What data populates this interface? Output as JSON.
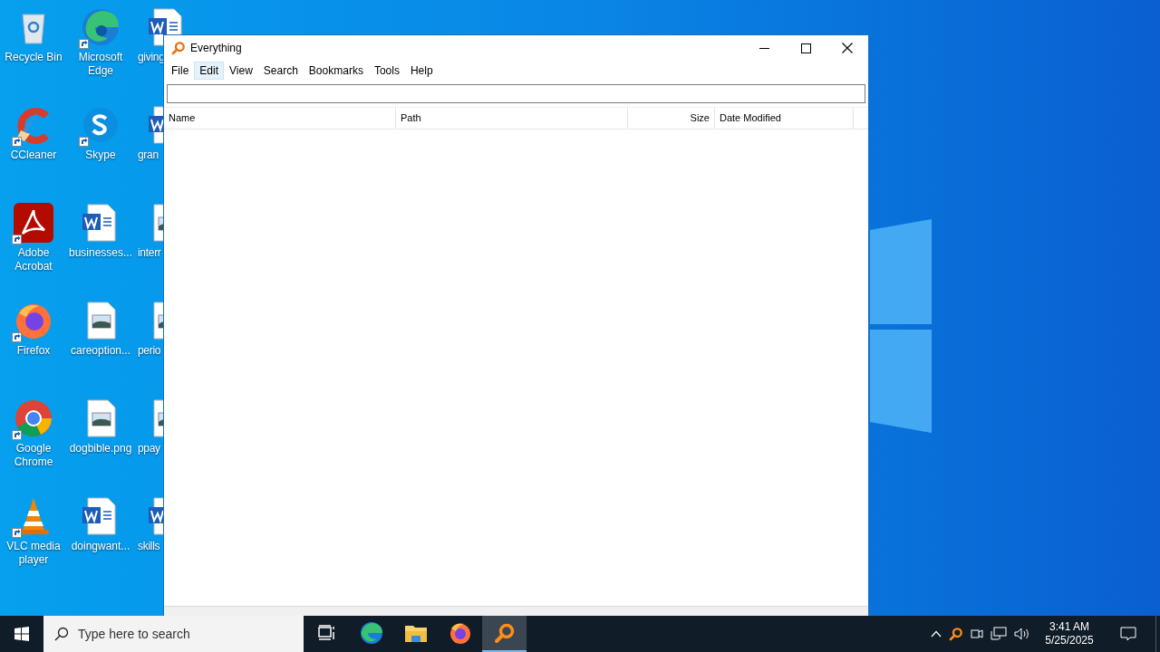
{
  "desktop": {
    "icons": [
      {
        "label": "Recycle Bin",
        "kind": "recycle",
        "shortcut": false
      },
      {
        "label": "CCleaner",
        "kind": "ccleaner",
        "shortcut": true
      },
      {
        "label": "Adobe Acrobat",
        "kind": "acrobat",
        "shortcut": true
      },
      {
        "label": "Firefox",
        "kind": "firefox",
        "shortcut": true
      },
      {
        "label": "Google Chrome",
        "kind": "chrome",
        "shortcut": true
      },
      {
        "label": "VLC media player",
        "kind": "vlc",
        "shortcut": true
      },
      {
        "label": "Microsoft Edge",
        "kind": "edge",
        "shortcut": true
      },
      {
        "label": "Skype",
        "kind": "skype",
        "shortcut": true
      },
      {
        "label": "businesses...",
        "kind": "word",
        "shortcut": false
      },
      {
        "label": "careoption...",
        "kind": "image",
        "shortcut": false
      },
      {
        "label": "dogbible.png",
        "kind": "image",
        "shortcut": false
      },
      {
        "label": "doingwant...",
        "kind": "word",
        "shortcut": false
      },
      {
        "label": "giving",
        "kind": "word",
        "shortcut": false
      },
      {
        "label": "gran",
        "kind": "word",
        "shortcut": false
      },
      {
        "label": "interr",
        "kind": "image",
        "shortcut": false
      },
      {
        "label": "perio",
        "kind": "image",
        "shortcut": false
      },
      {
        "label": "ppay",
        "kind": "image",
        "shortcut": false
      },
      {
        "label": "skills",
        "kind": "word",
        "shortcut": false
      }
    ]
  },
  "window": {
    "title": "Everything",
    "menu": [
      {
        "label": "File",
        "selected": false
      },
      {
        "label": "Edit",
        "selected": true
      },
      {
        "label": "View",
        "selected": false
      },
      {
        "label": "Search",
        "selected": false
      },
      {
        "label": "Bookmarks",
        "selected": false
      },
      {
        "label": "Tools",
        "selected": false
      },
      {
        "label": "Help",
        "selected": false
      }
    ],
    "columns": [
      {
        "label": "Name"
      },
      {
        "label": "Path"
      },
      {
        "label": "Size"
      },
      {
        "label": "Date Modified"
      }
    ]
  },
  "taskbar": {
    "search": {
      "placeholder": "Type here to search"
    },
    "apps": [
      {
        "kind": "taskview",
        "selected": false
      },
      {
        "kind": "edge",
        "selected": false
      },
      {
        "kind": "explorer",
        "selected": false
      },
      {
        "kind": "firefox",
        "selected": false
      },
      {
        "kind": "everything",
        "selected": true
      }
    ],
    "clock": {
      "time": "3:41 AM",
      "date": "5/25/2025"
    }
  }
}
